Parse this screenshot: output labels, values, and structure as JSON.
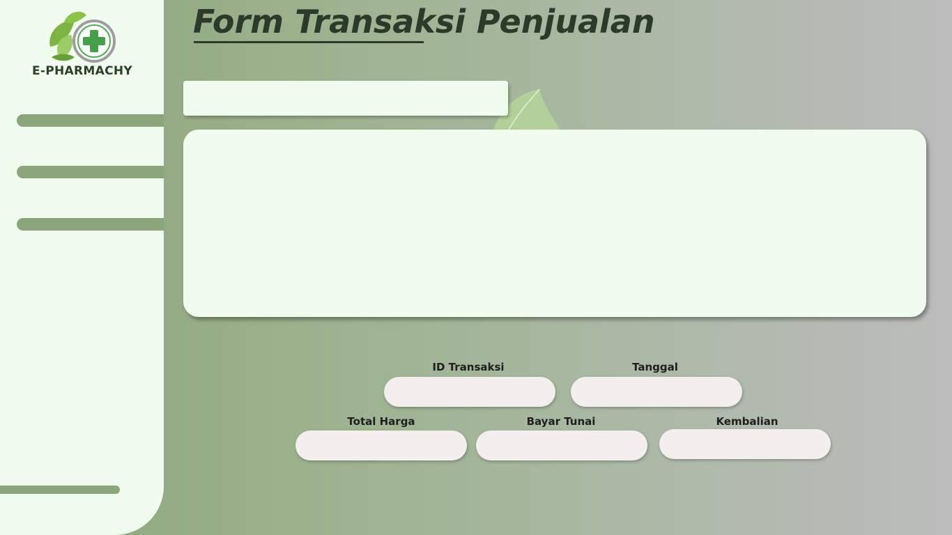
{
  "app": {
    "logo_text": "E-PHARMACHY"
  },
  "page": {
    "title": "Form Transaksi Penjualan"
  },
  "search": {
    "value": "",
    "placeholder": ""
  },
  "form": {
    "id_transaksi": {
      "label": "ID Transaksi",
      "value": ""
    },
    "tanggal": {
      "label": "Tanggal",
      "value": ""
    },
    "total_harga": {
      "label": "Total Harga",
      "value": ""
    },
    "bayar_tunai": {
      "label": "Bayar Tunai",
      "value": ""
    },
    "kembalian": {
      "label": "Kembalian",
      "value": ""
    }
  },
  "colors": {
    "sidebar_bg": "#f0fdee",
    "accent_green": "#8ca57b",
    "panel_bg": "#f0fdee",
    "title_color": "#2c3a29",
    "input_bg": "#f3efee"
  },
  "icons": {
    "logo": "leaf-cross-logo-icon",
    "decoration": "leaf-icon"
  }
}
